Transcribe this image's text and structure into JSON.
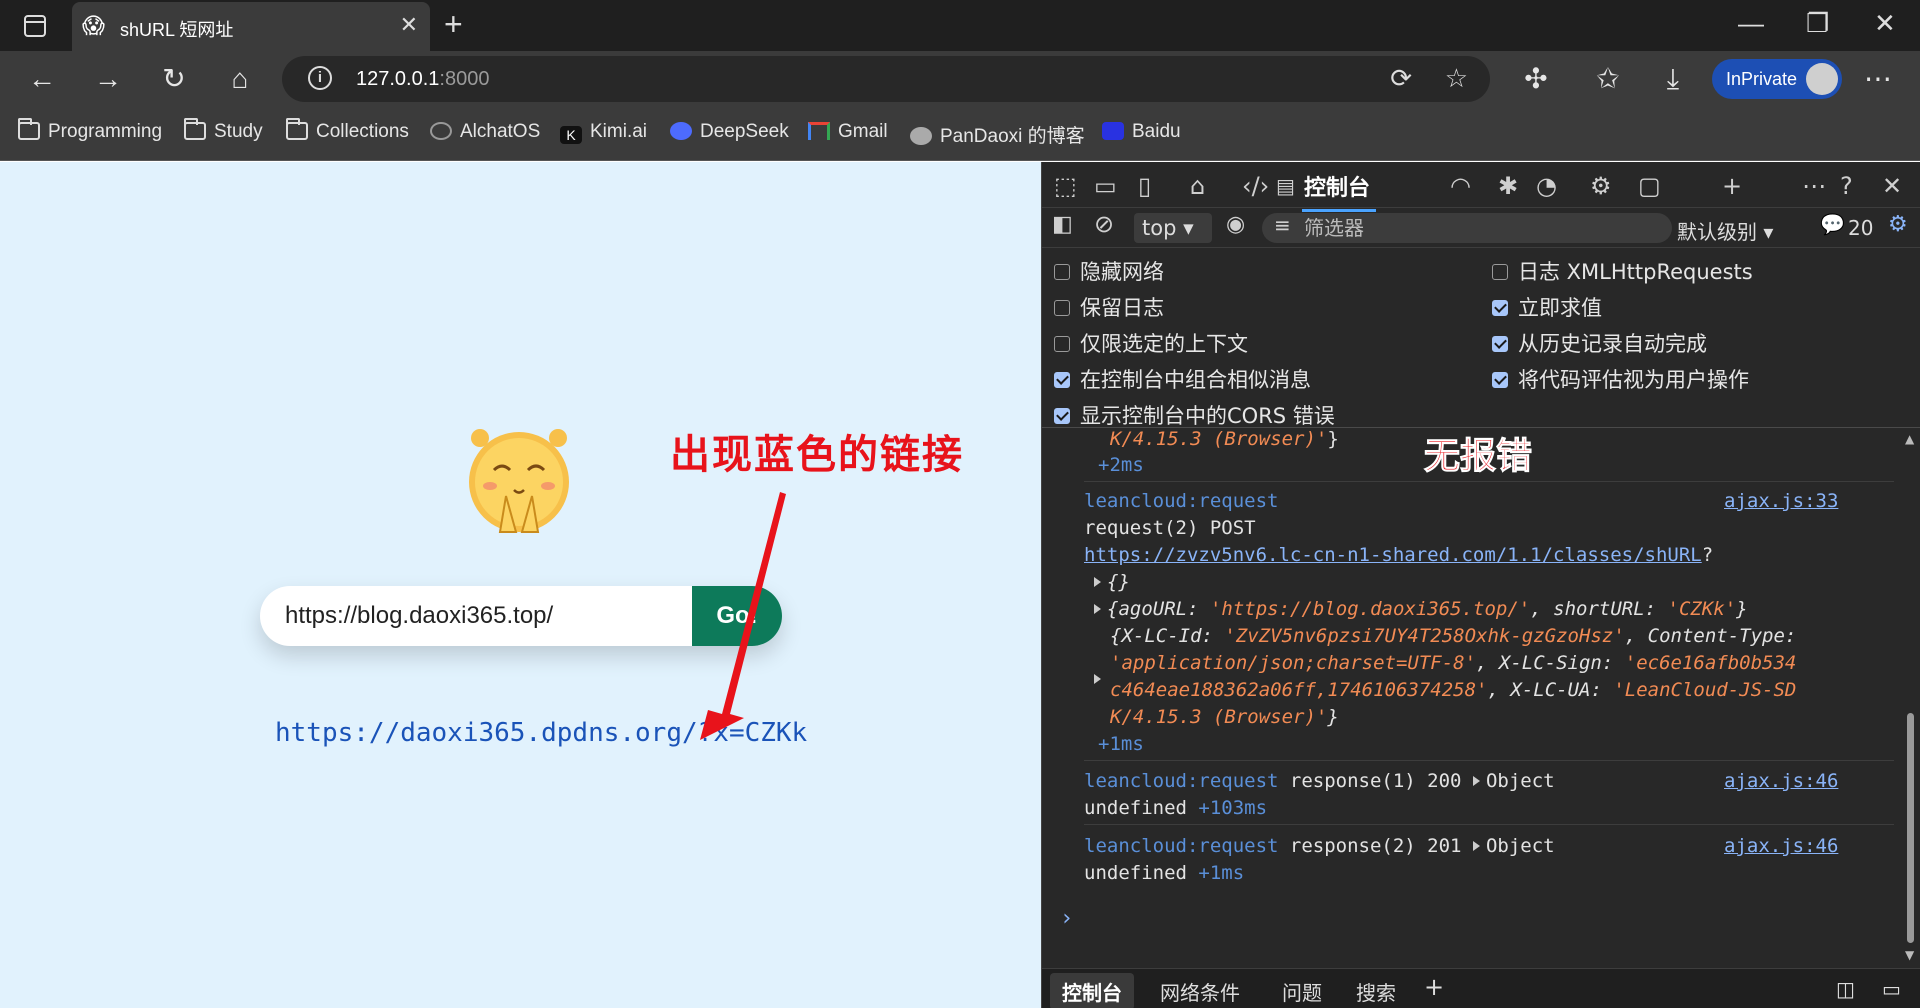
{
  "browser": {
    "tab_title": "shURL 短网址",
    "url_host": "127.0.0.1",
    "url_port": ":8000",
    "inprivate_label": "InPrivate"
  },
  "bookmarks": [
    {
      "label": "Programming",
      "icon": "folder-icon"
    },
    {
      "label": "Study",
      "icon": "folder-icon"
    },
    {
      "label": "Collections",
      "icon": "folder-icon"
    },
    {
      "label": "AlchatOS",
      "icon": "openai-icon"
    },
    {
      "label": "Kimi.ai",
      "icon": "kimi-icon"
    },
    {
      "label": "DeepSeek",
      "icon": "deepseek-icon"
    },
    {
      "label": "Gmail",
      "icon": "gmail-icon"
    },
    {
      "label": "PanDaoxi 的博客",
      "icon": "blog-icon"
    },
    {
      "label": "Baidu",
      "icon": "baidu-icon"
    }
  ],
  "page": {
    "input_value": "https://blog.daoxi365.top/",
    "go_label": "Go!",
    "short_link": "https://daoxi365.dpdns.org/?x=CZKk",
    "annotation": "出现蓝色的链接",
    "accent": "#0d7a5a"
  },
  "devtools": {
    "console_tab": "控制台",
    "context": "top",
    "filter_placeholder": "筛选器",
    "levels": "默认级别",
    "message_count": "20",
    "options": [
      {
        "label": "隐藏网络",
        "checked": false
      },
      {
        "label": "保留日志",
        "checked": false
      },
      {
        "label": "仅限选定的上下文",
        "checked": false
      },
      {
        "label": "在控制台中组合相似消息",
        "checked": true
      },
      {
        "label": "显示控制台中的CORS 错误",
        "checked": true
      },
      {
        "label": "日志 XMLHttpRequests",
        "checked": false
      },
      {
        "label": "立即求值",
        "checked": true
      },
      {
        "label": "从历史记录自动完成",
        "checked": true
      },
      {
        "label": "将代码评估视为用户操作",
        "checked": true
      }
    ],
    "annotation": "无报错",
    "log": {
      "top_tail": "K/4.15.3 (Browser)'",
      "top_tail_close": "}",
      "top_time": "+2ms",
      "entry1_ns": "leancloud:request",
      "entry1_src": "ajax.js:33",
      "entry1_line": "request(2) POST",
      "entry1_url": "https://zvzv5nv6.lc-cn-n1-shared.com/1.1/classes/shURL",
      "entry1_url_tail": "?",
      "obj_empty": "{}",
      "obj_body_key1": "{agoURL: ",
      "obj_body_val1": "'https://blog.daoxi365.top/'",
      "obj_body_key2": ", shortURL: ",
      "obj_body_val2": "'CZKk'",
      "obj_body_close": "}",
      "hdr_line1_a": "{X-LC-Id: ",
      "hdr_line1_b": "'ZvZV5nv6pzsi7UY4T258Oxhk-gzGzoHsz'",
      "hdr_line1_c": ", Content-Type:",
      "hdr_line2_a": "'application/json;charset=UTF-8'",
      "hdr_line2_b": ", X-LC-Sign: ",
      "hdr_line2_c": "'ec6e16afb0b534",
      "hdr_line3_a": "c464eae188362a06ff,1746106374258'",
      "hdr_line3_b": ", X-LC-UA: ",
      "hdr_line3_c": "'LeanCloud-JS-SD",
      "hdr_line4_a": "K/4.15.3 (Browser)'",
      "hdr_line4_b": "}",
      "entry1_time": "+1ms",
      "entry2_ns": "leancloud:request",
      "entry2_text": " response(1) 200 ",
      "entry2_obj": "Object",
      "entry2_src": "ajax.js:46",
      "entry2_tail": "undefined ",
      "entry2_time": "+103ms",
      "entry3_ns": "leancloud:request",
      "entry3_text": " response(2) 201 ",
      "entry3_obj": "Object",
      "entry3_src": "ajax.js:46",
      "entry3_tail": "undefined ",
      "entry3_time": "+1ms"
    },
    "drawer_tabs": [
      "控制台",
      "网络条件",
      "问题",
      "搜索"
    ]
  }
}
